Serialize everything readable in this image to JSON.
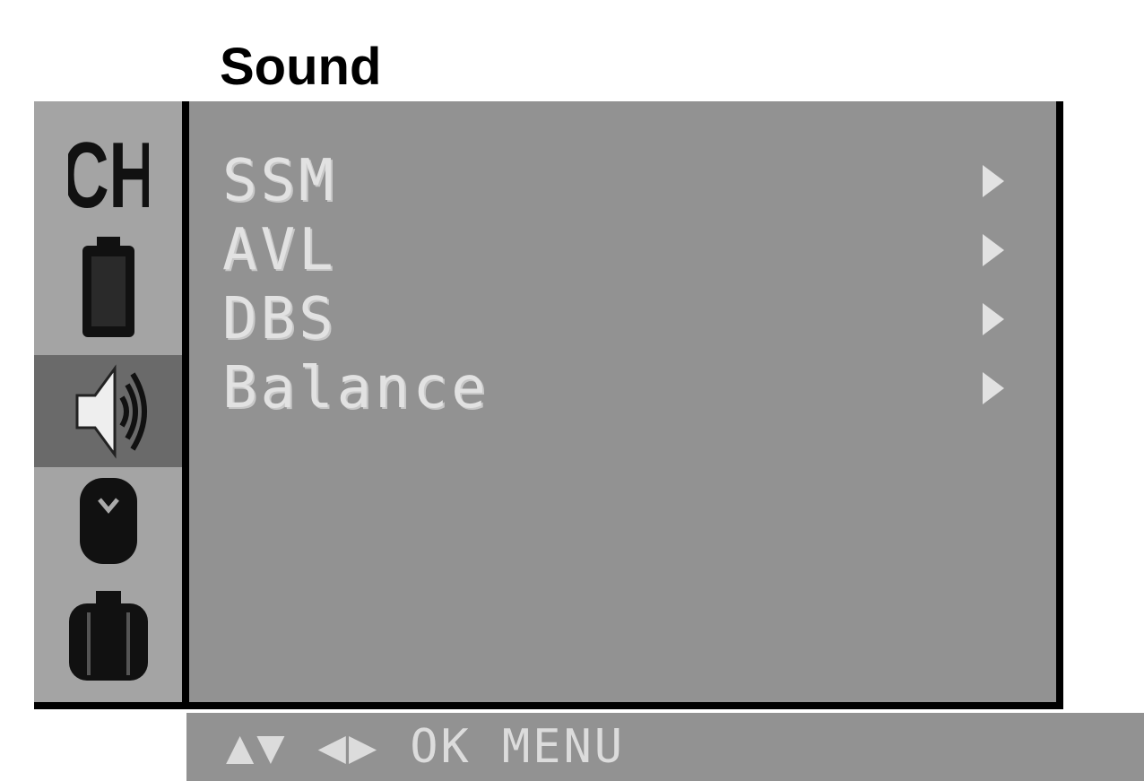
{
  "title": "Sound",
  "sidebar": {
    "items": [
      {
        "icon": "channel-ch-icon",
        "label": "CH",
        "selected": false
      },
      {
        "icon": "picture-icon",
        "selected": false
      },
      {
        "icon": "speaker-icon",
        "selected": true
      },
      {
        "icon": "time-icon",
        "selected": false
      },
      {
        "icon": "special-icon",
        "selected": false
      }
    ]
  },
  "menu": {
    "items": [
      {
        "label": "SSM"
      },
      {
        "label": "AVL"
      },
      {
        "label": "DBS"
      },
      {
        "label": "Balance"
      }
    ]
  },
  "footer": {
    "updown": "▲▼",
    "leftright": "◀▶",
    "ok": "OK",
    "menu": "MENU"
  },
  "colors": {
    "panel": "#929292",
    "sidebar": "#a4a4a4",
    "selected": "#6a6a6a",
    "text": "#e2e2e2"
  }
}
